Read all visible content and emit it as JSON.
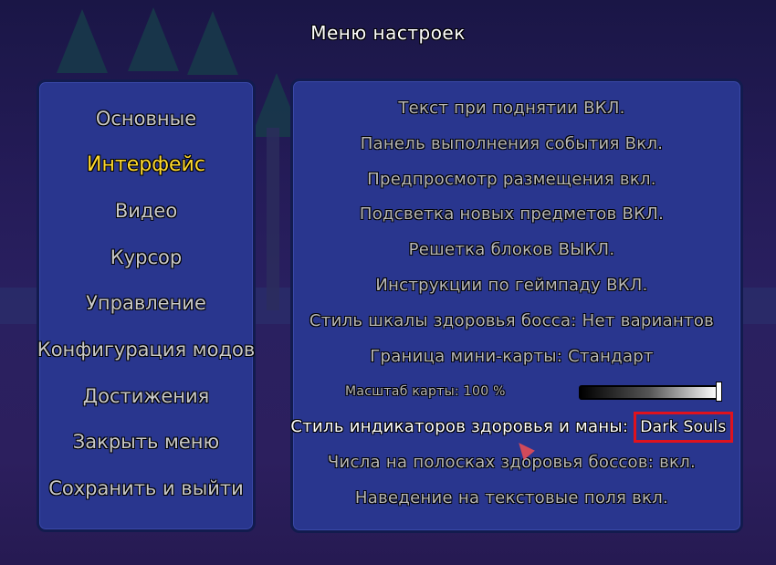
{
  "title": "Меню настроек",
  "categories": [
    {
      "label": "Основные"
    },
    {
      "label": "Интерфейс"
    },
    {
      "label": "Видео"
    },
    {
      "label": "Курсор"
    },
    {
      "label": "Управление"
    },
    {
      "label": "Конфигурация модов"
    },
    {
      "label": "Достижения"
    },
    {
      "label": "Закрыть меню"
    },
    {
      "label": "Сохранить и выйти"
    }
  ],
  "active_category": "Интерфейс",
  "options": [
    "Текст при поднятии ВКЛ.",
    "Панель выполнения события Вкл.",
    "Предпросмотр размещения вкл.",
    "Подсветка новых предметов ВКЛ.",
    "Решетка блоков ВЫКЛ.",
    "Инструкции по геймпаду ВКЛ.",
    "Стиль шкалы здоровья босса: Нет вариантов",
    "Граница мини-карты: Стандарт"
  ],
  "map_scale": {
    "label": "Масштаб карты: 100 %",
    "value_percent": 100
  },
  "health_style": {
    "label": "Стиль индикаторов здоровья и маны:",
    "value": "Dark Souls"
  },
  "options_after": [
    "Числа на  полосках здоровья боссов: вкл.",
    "Наведение на текстовые поля вкл."
  ],
  "colors": {
    "active": "#ffd92e",
    "highlight_box": "#e0121d",
    "panel": "#29368e"
  }
}
